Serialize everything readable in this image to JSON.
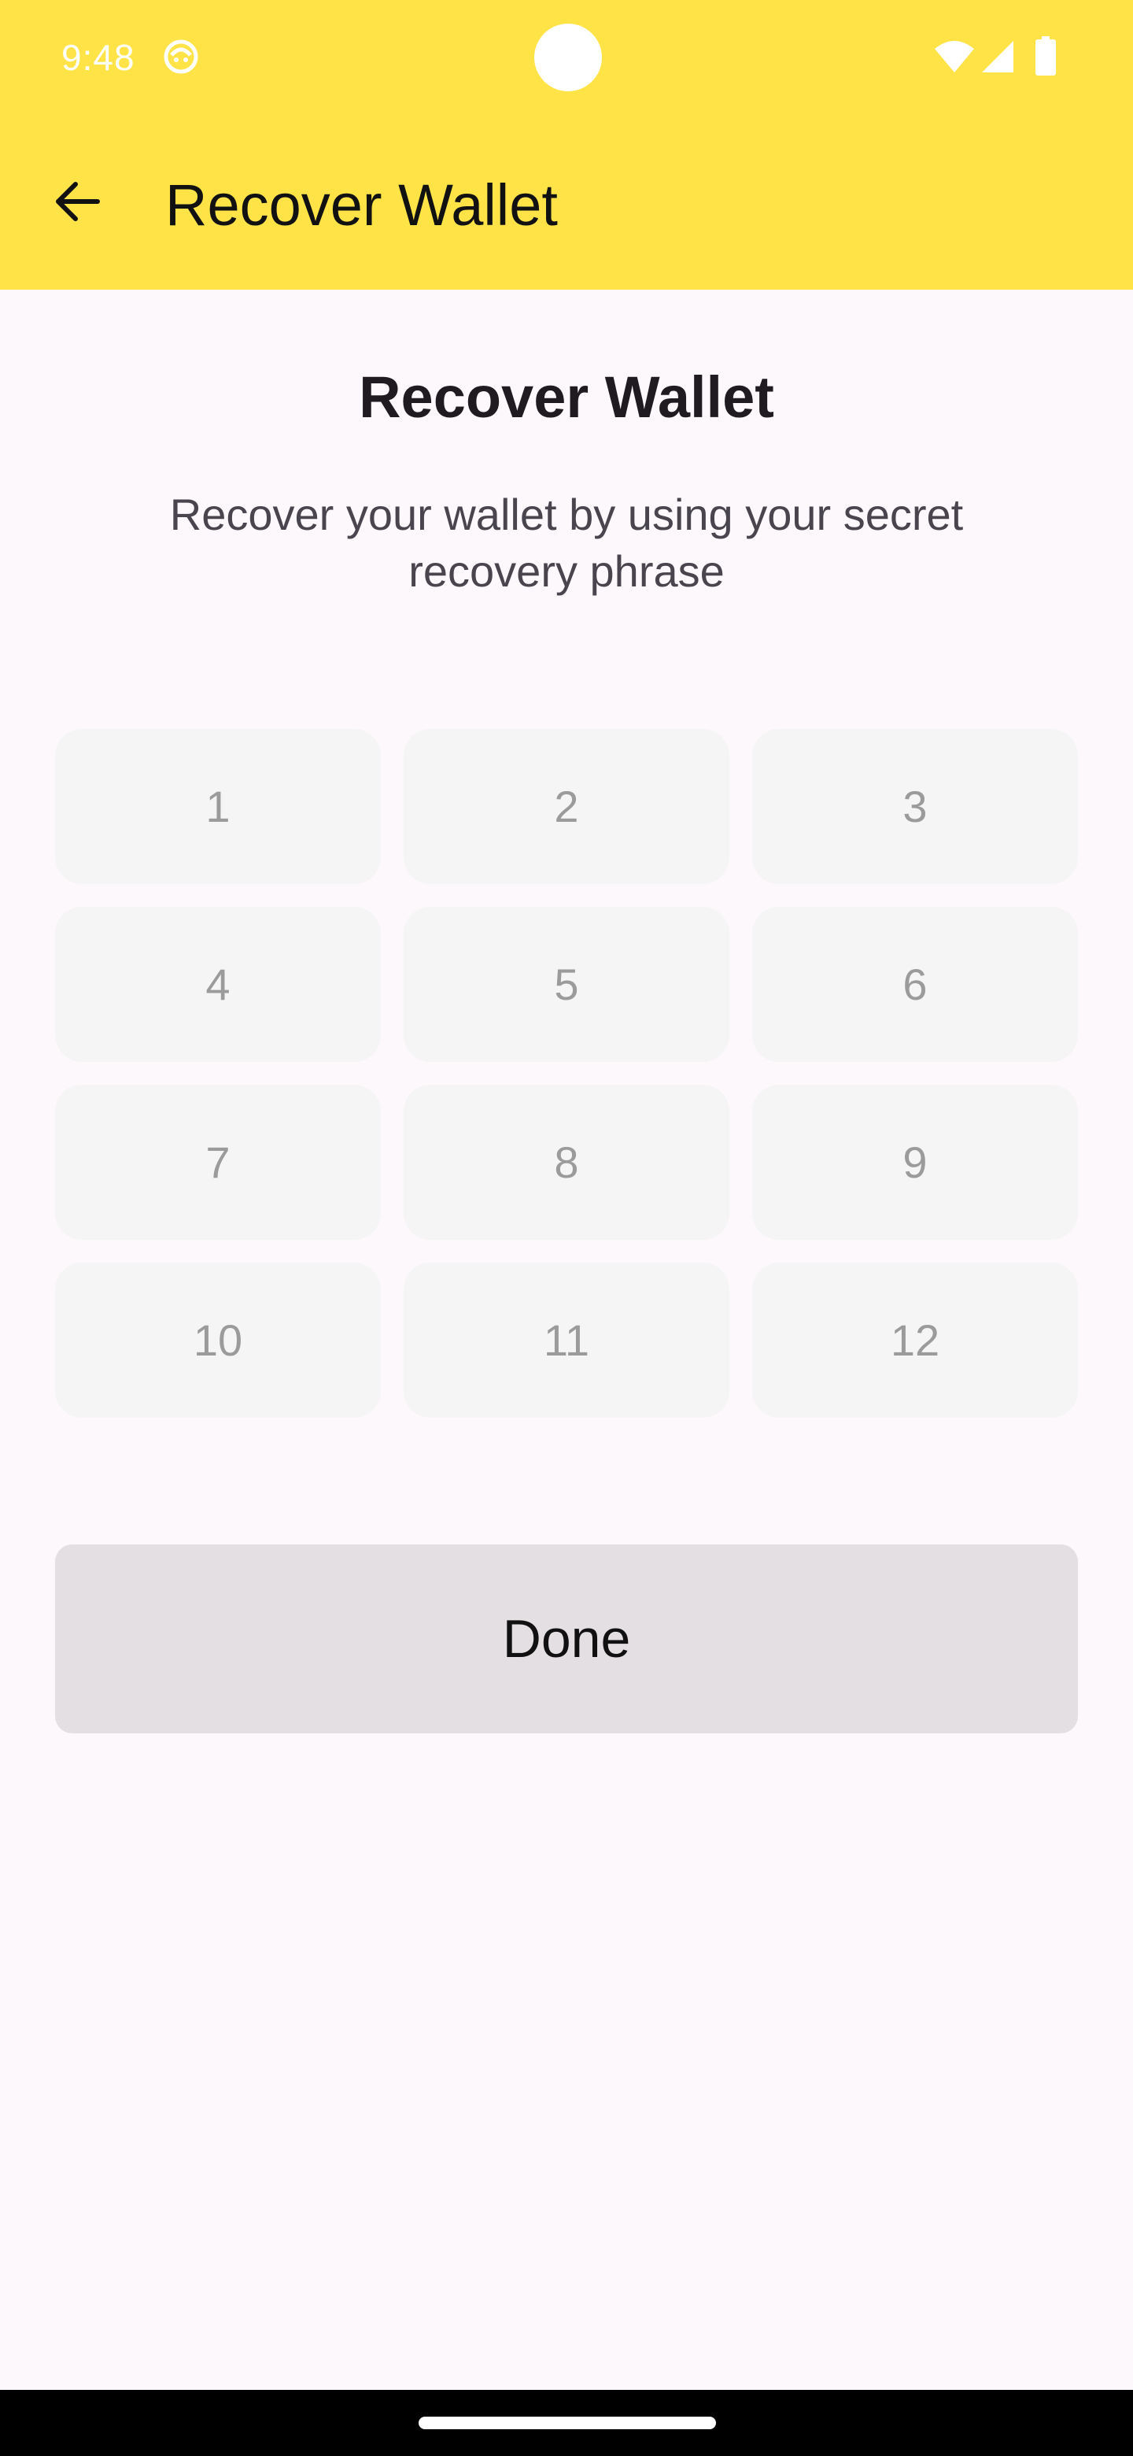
{
  "status_bar": {
    "time": "9:48",
    "icons": [
      "app-notification-icon",
      "wifi-icon",
      "signal-icon",
      "battery-icon"
    ]
  },
  "toolbar": {
    "title": "Recover Wallet",
    "back_icon": "arrow-back-icon"
  },
  "content": {
    "title": "Recover Wallet",
    "subtitle": "Recover your wallet by using your secret recovery phrase"
  },
  "phrase_grid": {
    "placeholders": [
      "1",
      "2",
      "3",
      "4",
      "5",
      "6",
      "7",
      "8",
      "9",
      "10",
      "11",
      "12"
    ]
  },
  "done_button": {
    "label": "Done"
  },
  "colors": {
    "appbar": "#ffe347",
    "background": "#fdf8fb",
    "cell": "#f4f5f4",
    "button": "#e3dfe2"
  }
}
